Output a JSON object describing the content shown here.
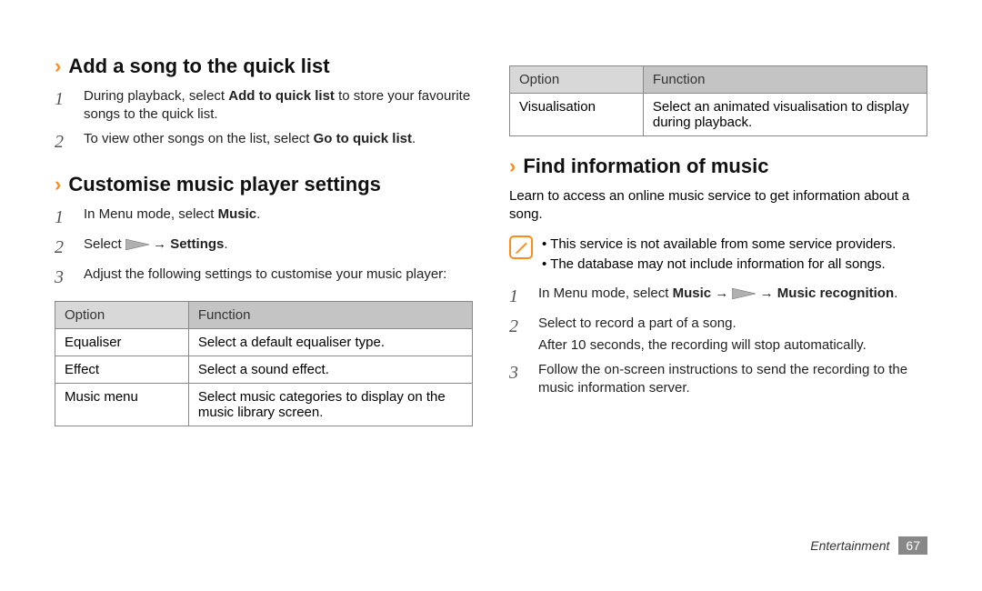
{
  "left": {
    "s1": {
      "title": "Add a song to the quick list",
      "step1_a": "During playback, select ",
      "step1_b": "Add to quick list",
      "step1_c": " to store your favourite songs to the quick list.",
      "step2_a": "To view other songs on the list, select ",
      "step2_b": "Go to quick list",
      "step2_c": "."
    },
    "s2": {
      "title": "Customise music player settings",
      "step1_a": "In Menu mode, select ",
      "step1_b": "Music",
      "step1_c": ".",
      "step2_a": "Select ",
      "step2_arrow": " → ",
      "step2_b": "Settings",
      "step2_c": ".",
      "step3": "Adjust the following settings to customise your music player:",
      "th_opt": "Option",
      "th_fun": "Function",
      "r1_o": "Equaliser",
      "r1_f": "Select a default equaliser type.",
      "r2_o": "Effect",
      "r2_f": "Select a sound effect.",
      "r3_o": "Music menu",
      "r3_f": "Select music categories to display on the music library screen."
    }
  },
  "right": {
    "th_opt": "Option",
    "th_fun": "Function",
    "r1_o": "Visualisation",
    "r1_f": "Select an animated visualisation to display during playback.",
    "s3": {
      "title": "Find information of music",
      "intro": "Learn to access an online music service to get information about a song.",
      "note1": "This service is not available from some service providers.",
      "note2": "The database may not include information for all songs.",
      "step1_a": "In Menu mode, select ",
      "step1_b": "Music",
      "step1_arrow1": " → ",
      "step1_arrow2": " → ",
      "step1_c": "Music recognition",
      "step1_d": ".",
      "step2_a": "Select     to record a part of a song.",
      "step2_sub": "After 10 seconds, the recording will stop automatically.",
      "step3": "Follow the on-screen instructions to send the recording to the music information server."
    }
  },
  "footer": {
    "category": "Entertainment",
    "page": "67"
  }
}
